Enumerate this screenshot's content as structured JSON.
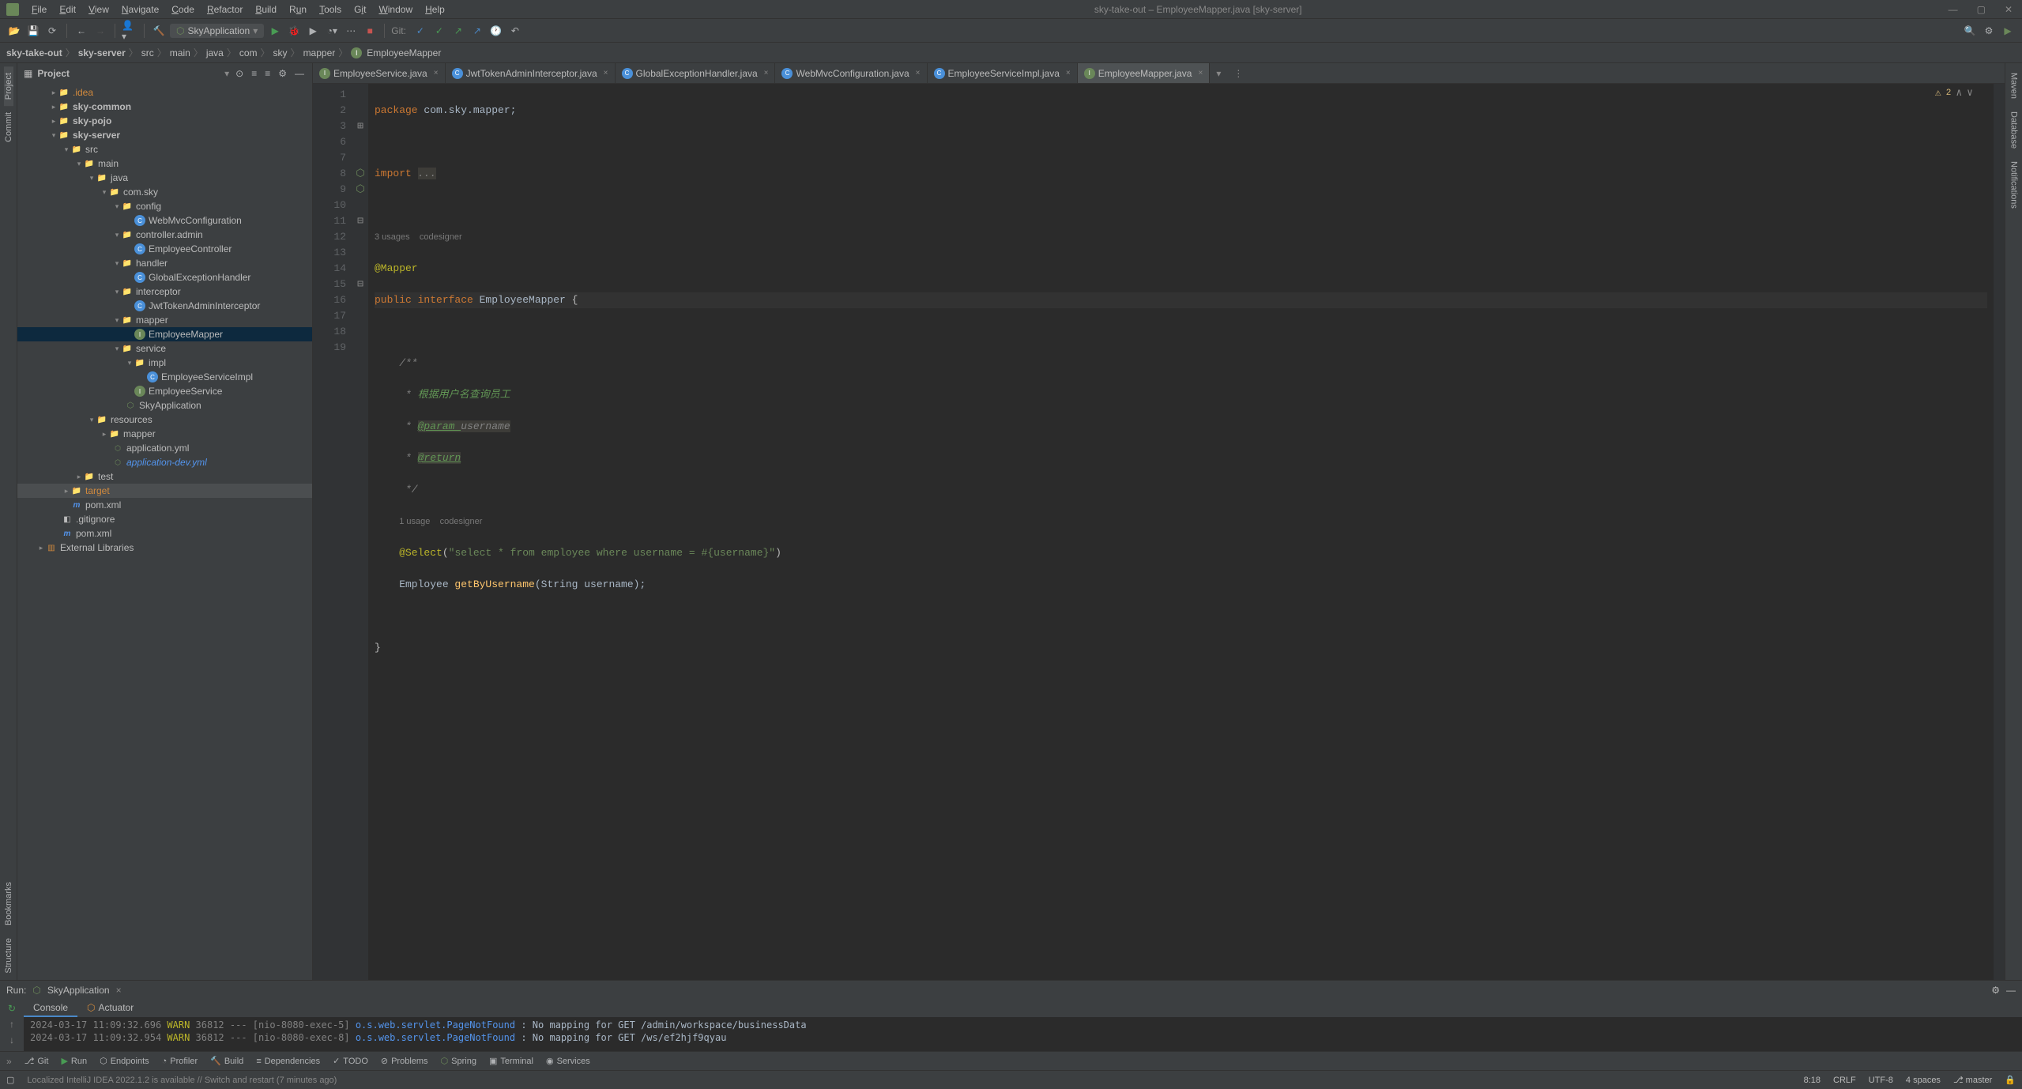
{
  "window": {
    "title": "sky-take-out – EmployeeMapper.java [sky-server]"
  },
  "menu": [
    "File",
    "Edit",
    "View",
    "Navigate",
    "Code",
    "Refactor",
    "Build",
    "Run",
    "Tools",
    "Git",
    "Window",
    "Help"
  ],
  "toolbar": {
    "run_config": "SkyApplication",
    "git_label": "Git:"
  },
  "breadcrumb": [
    "sky-take-out",
    "sky-server",
    "src",
    "main",
    "java",
    "com",
    "sky",
    "mapper",
    "EmployeeMapper"
  ],
  "project_header": {
    "title": "Project"
  },
  "tree": {
    "idea": ".idea",
    "sky_common": "sky-common",
    "sky_pojo": "sky-pojo",
    "sky_server": "sky-server",
    "src": "src",
    "main": "main",
    "java": "java",
    "com_sky": "com.sky",
    "config": "config",
    "WebMvcConfiguration": "WebMvcConfiguration",
    "controller_admin": "controller.admin",
    "EmployeeController": "EmployeeController",
    "handler": "handler",
    "GlobalExceptionHandler": "GlobalExceptionHandler",
    "interceptor": "interceptor",
    "JwtTokenAdminInterceptor": "JwtTokenAdminInterceptor",
    "mapper": "mapper",
    "EmployeeMapper": "EmployeeMapper",
    "service": "service",
    "impl": "impl",
    "EmployeeServiceImpl": "EmployeeServiceImpl",
    "EmployeeService": "EmployeeService",
    "SkyApplication": "SkyApplication",
    "resources": "resources",
    "mapper_res": "mapper",
    "app_yml": "application.yml",
    "app_dev_yml": "application-dev.yml",
    "test": "test",
    "target": "target",
    "pom_xml": "pom.xml",
    "gitignore": ".gitignore",
    "pom_root": "pom.xml",
    "ext_lib": "External Libraries"
  },
  "tabs": [
    {
      "label": "EmployeeService.java",
      "icon": "green"
    },
    {
      "label": "JwtTokenAdminInterceptor.java",
      "icon": "blue"
    },
    {
      "label": "GlobalExceptionHandler.java",
      "icon": "blue"
    },
    {
      "label": "WebMvcConfiguration.java",
      "icon": "blue"
    },
    {
      "label": "EmployeeServiceImpl.java",
      "icon": "blue"
    },
    {
      "label": "EmployeeMapper.java",
      "icon": "green",
      "active": true
    }
  ],
  "editor": {
    "warnings": "2",
    "lines": {
      "l1": "package com.sky.mapper;",
      "l2": "",
      "l3": "import ...",
      "l4": "",
      "l5_hint": "3 usages    codesigner",
      "l6": "@Mapper",
      "l7_pub": "public ",
      "l7_int": "interface ",
      "l7_name": "EmployeeMapper ",
      "l7_brace": "{",
      "l8": "",
      "l9": "    /**",
      "l10_pre": "     * ",
      "l10_txt": "根据用户名查询员工",
      "l11_pre": "     * ",
      "l11_tag": "@param ",
      "l11_name": "username",
      "l12_pre": "     * ",
      "l12_tag": "@return",
      "l13": "     */",
      "l13_hint": "1 usage    codesigner",
      "l14_anno": "    @Select",
      "l14_paren": "(",
      "l14_str": "\"select * from employee where username = #{username}\"",
      "l14_close": ")",
      "l15_type": "    Employee ",
      "l15_method": "getByUsername",
      "l15_params": "(String username);",
      "l16": "",
      "l17": "}",
      "l18": ""
    },
    "gutter": [
      "1",
      "2",
      "3",
      "6",
      "",
      "7",
      "8",
      "9",
      "10",
      "11",
      "12",
      "13",
      "14",
      "",
      "15",
      "16",
      "17",
      "18",
      "19"
    ]
  },
  "run": {
    "label": "Run:",
    "config": "SkyApplication",
    "tabs": [
      "Console",
      "Actuator"
    ],
    "log1": {
      "time": "2024-03-17 11:09:32.696  ",
      "level": "WARN ",
      "pid": "36812 --- [nio-8080-exec-5] ",
      "class": "o.s.web.servlet.PageNotFound",
      "sep": "             : ",
      "msg": "No mapping for GET /admin/workspace/businessData"
    },
    "log2": {
      "time": "2024-03-17 11:09:32.954  ",
      "level": "WARN ",
      "pid": "36812 --- [nio-8080-exec-8] ",
      "class": "o.s.web.servlet.PageNotFound",
      "sep": "             : ",
      "msg": "No mapping for GET /ws/ef2hjf9qyau"
    }
  },
  "bottom_tools": [
    "Git",
    "Run",
    "Endpoints",
    "Profiler",
    "Build",
    "Dependencies",
    "TODO",
    "Problems",
    "Spring",
    "Terminal",
    "Services"
  ],
  "status": {
    "msg": "Localized IntelliJ IDEA 2022.1.2 is available // Switch and restart (7 minutes ago)",
    "pos": "8:18",
    "crlf": "CRLF",
    "enc": "UTF-8",
    "indent": "4 spaces",
    "branch": "master"
  },
  "left_labels": [
    "Project",
    "Commit",
    "Bookmarks",
    "Structure"
  ],
  "right_labels": [
    "Maven",
    "Database",
    "Notifications"
  ]
}
